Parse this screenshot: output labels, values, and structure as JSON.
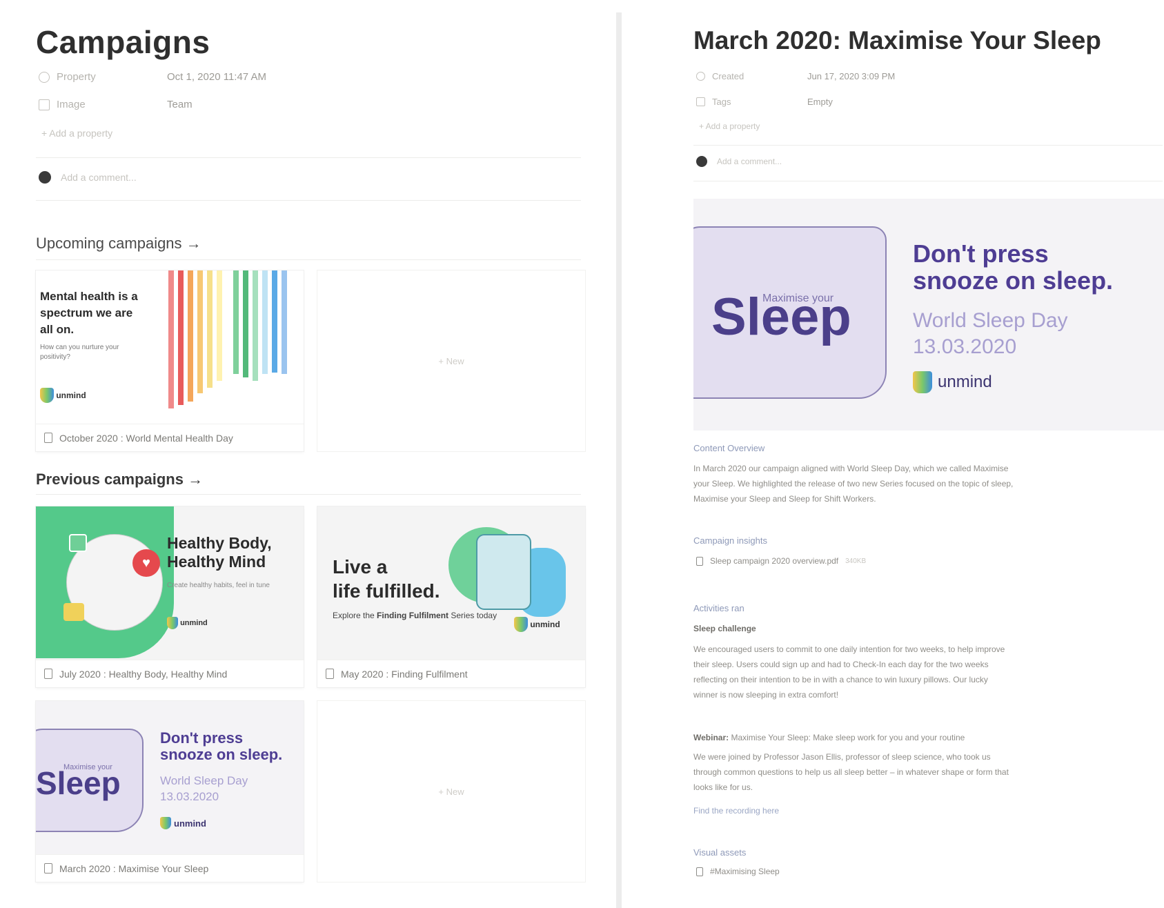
{
  "left": {
    "title": "Campaigns",
    "properties": [
      {
        "icon": "clock-icon",
        "name": "Property",
        "value": "Oct 1, 2020 11:47 AM"
      },
      {
        "icon": "image-icon",
        "name": "Image",
        "value": "Team"
      }
    ],
    "add_property": "+ Add a property",
    "add_comment": "Add a comment...",
    "upcoming_heading": "Upcoming campaigns →",
    "previous_heading": "Previous campaigns →",
    "new_label": "+ New",
    "upcoming_card": {
      "headline": "Mental health is a spectrum we are all on.",
      "sub": "How can you nurture your positivity?",
      "brand": "unmind",
      "caption": "October 2020 : World Mental Health Day"
    },
    "healthy_card": {
      "title_line1": "Healthy Body,",
      "title_line2": "Healthy Mind",
      "sub": "Create healthy habits, feel in tune",
      "brand": "unmind",
      "caption": "July 2020 : Healthy Body, Healthy Mind"
    },
    "fulfilled_card": {
      "title_line1": "Live a",
      "title_line2": "life fulfilled.",
      "sub_pre": "Explore the ",
      "sub_bold": "Finding Fulfilment",
      "sub_post": " Series today",
      "brand": "unmind",
      "caption": "May 2020 : Finding Fulfilment"
    },
    "sleep_card": {
      "maximise": "Maximise your",
      "word": "Sleep",
      "title_line1": "Don't press",
      "title_line2": "snooze on sleep.",
      "date_line1": "World Sleep Day",
      "date_line2": "13.03.2020",
      "brand": "unmind",
      "caption": "March 2020 : Maximise Your Sleep"
    }
  },
  "right": {
    "title": "March 2020: Maximise Your Sleep",
    "properties": [
      {
        "icon": "clock-icon",
        "name": "Created",
        "value": "Jun 17, 2020 3:09 PM"
      },
      {
        "icon": "tag-icon",
        "name": "Tags",
        "value": "Empty"
      }
    ],
    "add_property": "+ Add a property",
    "add_comment": "Add a comment...",
    "banner": {
      "maximise": "Maximise your",
      "word": "Sleep",
      "title_line1": "Don't press",
      "title_line2": "snooze on sleep.",
      "date_line1": "World Sleep Day",
      "date_line2": "13.03.2020",
      "brand": "unmind"
    },
    "content_overview_label": "Content Overview",
    "content_overview_text_1": "In March 2020 our campaign aligned with World Sleep Day, which we called Maximise",
    "content_overview_text_2": "your Sleep. We highlighted the release of two new Series focused on the topic of sleep,",
    "content_overview_text_3": "Maximise your Sleep and Sleep for Shift Workers.",
    "insights_label": "Campaign insights",
    "insights_file": "Sleep campaign 2020 overview.pdf",
    "insights_size": "340KB",
    "activities_label": "Activities ran",
    "challenge_title": "Sleep challenge",
    "challenge_text_1": "We encouraged users to commit to one daily intention for two weeks, to help improve",
    "challenge_text_2": "their sleep. Users could sign up and had to Check-In each day for the two weeks",
    "challenge_text_3": "reflecting on their intention to be in with a chance to win luxury pillows. Our lucky",
    "challenge_text_4": "winner is now sleeping in extra comfort!",
    "webinar_bold": "Webinar:",
    "webinar_title": " Maximise Your Sleep: Make sleep work for you and your routine",
    "webinar_text_1": "We were joined by Professor Jason Ellis, professor of sleep science, who took us",
    "webinar_text_2": "through common questions to help us all sleep better – in whatever shape or form that",
    "webinar_text_3": "looks like for us.",
    "recording_link": "Find the recording here",
    "visual_assets_label": "Visual assets",
    "visual_assets_item": "#Maximising Sleep"
  }
}
